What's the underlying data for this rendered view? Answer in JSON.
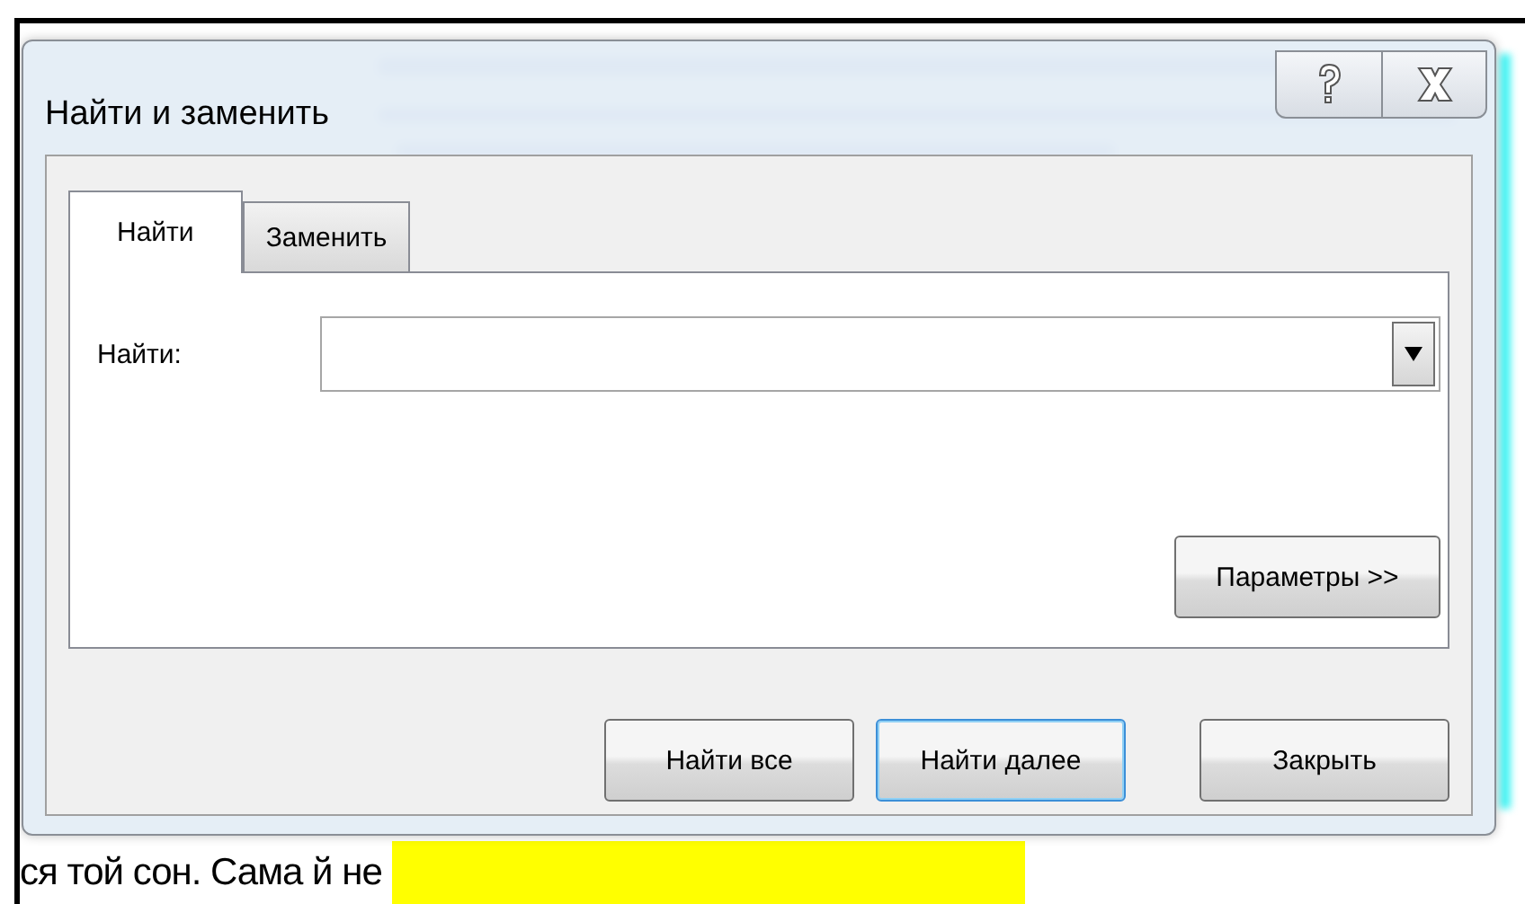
{
  "dialog": {
    "title": "Найти и заменить",
    "tabs": [
      {
        "label": "Найти",
        "selected": true
      },
      {
        "label": "Заменить",
        "selected": false
      }
    ],
    "find_field": {
      "label": "Найти:"
    },
    "options_button": "Параметры >>",
    "buttons": [
      {
        "label": "Найти все",
        "focused": false
      },
      {
        "label": "Найти далее",
        "focused": true
      },
      {
        "label": "Закрыть",
        "focused": false
      }
    ]
  },
  "document": {
    "visible_line": "ся той сон. Сама й не",
    "highlight": true
  }
}
